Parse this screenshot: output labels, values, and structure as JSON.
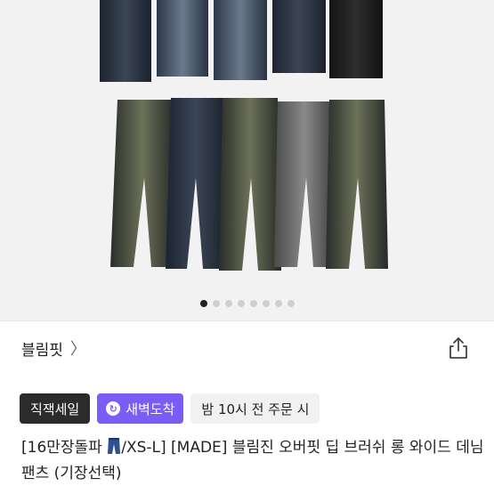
{
  "gallery": {
    "dot_count": 8,
    "active_index": 0
  },
  "brand": {
    "name": "블림핏",
    "chevron": "〉"
  },
  "icons": {
    "share": "share-icon",
    "dawn": "refresh-arrow-icon",
    "jeans_emoji": "jeans-emoji"
  },
  "badges": {
    "sale": "직잭세일",
    "dawn": "새벽도착",
    "time": "밤 10시 전 주문 시"
  },
  "product": {
    "title_part1": "[16만장돌파 ",
    "title_part2": "/XS-L] [MADE] 블림진 오버핏 딥 브러쉬 롱 와이드 데님 팬츠 (기장선택)"
  },
  "colors": {
    "accent": "#7b5cf5",
    "dark_badge": "#2b2b2b"
  }
}
